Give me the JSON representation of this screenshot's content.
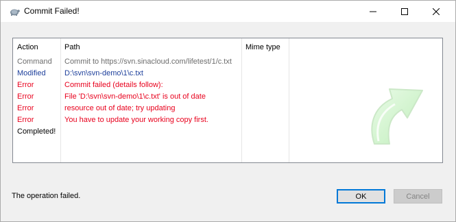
{
  "window": {
    "title": "Commit Failed!",
    "controls": {
      "minimize": "minimize",
      "maximize": "maximize",
      "close": "close"
    }
  },
  "list": {
    "columns": {
      "action": "Action",
      "path": "Path",
      "mime": "Mime type"
    },
    "rows": [
      {
        "action": "Command",
        "path": "Commit to https://svn.sinacloud.com/lifetest/1/c.txt",
        "kind": "command"
      },
      {
        "action": "Modified",
        "path": "D:\\svn\\svn-demo\\1\\c.txt",
        "kind": "modified"
      },
      {
        "action": "Error",
        "path": "Commit failed (details follow):",
        "kind": "error"
      },
      {
        "action": "Error",
        "path": "File 'D:\\svn\\svn-demo\\1\\c.txt' is out of date",
        "kind": "error"
      },
      {
        "action": "Error",
        "path": "resource out of date; try updating",
        "kind": "error"
      },
      {
        "action": "Error",
        "path": "You have to update your working copy first.",
        "kind": "error"
      },
      {
        "action": "Completed!",
        "path": "",
        "kind": "completed"
      }
    ],
    "colors": {
      "command": "#6d6d6d",
      "modified": "#1d3f9b",
      "error": "#e8001c",
      "completed": "#000000"
    }
  },
  "status_text": "The operation failed.",
  "buttons": {
    "ok": "OK",
    "cancel": "Cancel"
  },
  "icons": {
    "app": "tortoise-icon",
    "animation": "commit-arrow-icon"
  }
}
